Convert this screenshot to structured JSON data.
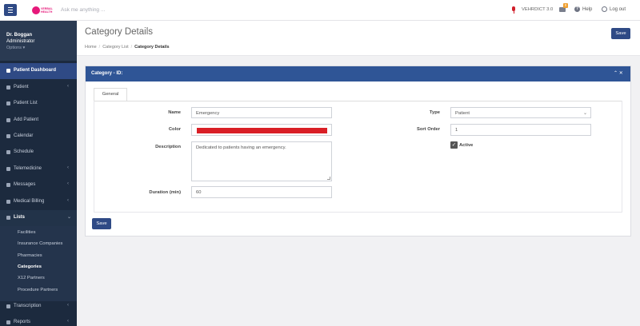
{
  "topbar": {
    "menu_icon": "hamburger-icon",
    "logo_text": "VERBAL\nHEALTH",
    "search_placeholder": "Ask me anything ...",
    "version": "VEHRDICT 3.0",
    "notification_count": "0",
    "help_label": "Help",
    "logout_label": "Log out"
  },
  "user": {
    "name": "Dr. Boggan",
    "role": "Administrator",
    "options": "Options ▾"
  },
  "sidebar": {
    "items": [
      {
        "label": "Patient Dashboard",
        "icon": "dashboard-icon"
      },
      {
        "label": "Patient",
        "icon": "user-icon",
        "chevron": "‹"
      },
      {
        "label": "Patient List",
        "icon": "users-icon"
      },
      {
        "label": "Add Patient",
        "icon": "user-plus-icon"
      },
      {
        "label": "Calendar",
        "icon": "calendar-icon"
      },
      {
        "label": "Schedule",
        "icon": "schedule-icon"
      },
      {
        "label": "Telemedicine",
        "icon": "video-icon",
        "chevron": "‹"
      },
      {
        "label": "Messages",
        "icon": "envelope-icon",
        "chevron": "‹"
      },
      {
        "label": "Medical Billing",
        "icon": "billing-icon",
        "chevron": "‹"
      },
      {
        "label": "Lists",
        "icon": "list-icon",
        "chevron": "⌄"
      },
      {
        "label": "Transcription",
        "icon": "pencil-icon",
        "chevron": "‹"
      },
      {
        "label": "Reports",
        "icon": "reports-icon",
        "chevron": "‹"
      }
    ],
    "sub_items": [
      "Facilities",
      "Insurance Companies",
      "Pharmacies",
      "Categories",
      "X12 Partners",
      "Procedure Partners"
    ]
  },
  "page": {
    "title": "Category Details",
    "save_label": "Save",
    "breadcrumb": [
      "Home",
      "Category List",
      "Category Details"
    ]
  },
  "card": {
    "title": "Category - ID:",
    "tools": "⌃ ✕",
    "tab": "General"
  },
  "form": {
    "name_label": "Name",
    "name_value": "Emergency",
    "color_label": "Color",
    "color_value": "#d91f26",
    "description_label": "Description",
    "description_value": "Dedicated to patients having an emergency.",
    "duration_label": "Duration (min)",
    "duration_value": "60",
    "type_label": "Type",
    "type_value": "Patient",
    "sort_label": "Sort Order",
    "sort_value": "1",
    "active_label": "Active",
    "active_checked": true,
    "save_label": "Save"
  }
}
